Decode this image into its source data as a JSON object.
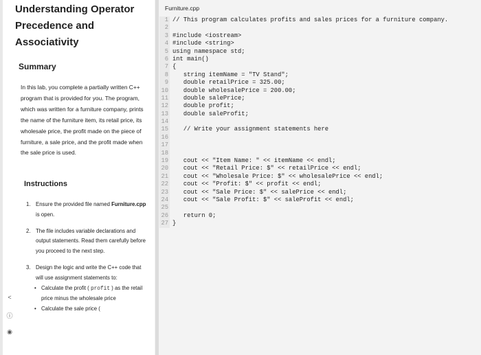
{
  "lesson": {
    "title": "Understanding Operator Precedence and Associativity",
    "summary_heading": "Summary",
    "summary_text": "In this lab, you complete a partially written C++ program that is provided for you. The program, which was written for a furniture company, prints the name of the furniture item, its retail price, its wholesale price, the profit made on the piece of furniture, a sale price, and the profit made when the sale price is used.",
    "instructions_heading": "Instructions",
    "steps": [
      {
        "num": "1.",
        "before": "Ensure the provided file named ",
        "strong": "Furniture.cpp",
        "after": " is open."
      },
      {
        "num": "2.",
        "text": "The file includes variable declarations and output statements. Read them carefully before you proceed to the next step."
      },
      {
        "num": "3.",
        "text": "Design the logic and write the C++ code that will use assignment statements to:"
      }
    ],
    "substeps": [
      {
        "before": "Calculate the profit ( ",
        "code": "profit",
        "after": " ) as the retail price minus the wholesale price"
      },
      {
        "before": "Calculate the sale price (",
        "code": "",
        "after": ""
      }
    ]
  },
  "editor": {
    "filename": "Furniture.cpp",
    "lines": [
      "// This program calculates profits and sales prices for a furniture company.",
      "",
      "#include <iostream>",
      "#include <string>",
      "using namespace std;",
      "int main()",
      "{",
      "   string itemName = \"TV Stand\";",
      "   double retailPrice = 325.00;",
      "   double wholesalePrice = 200.00;",
      "   double salePrice;",
      "   double profit;",
      "   double saleProfit;",
      "",
      "   // Write your assignment statements here",
      "",
      "",
      "",
      "   cout << \"Item Name: \" << itemName << endl;",
      "   cout << \"Retail Price: $\" << retailPrice << endl;",
      "   cout << \"Wholesale Price: $\" << wholesalePrice << endl;",
      "   cout << \"Profit: $\" << profit << endl;",
      "   cout << \"Sale Price: $\" << salePrice << endl;",
      "   cout << \"Sale Profit: $\" << saleProfit << endl;",
      "",
      "   return 0;",
      "}"
    ]
  }
}
